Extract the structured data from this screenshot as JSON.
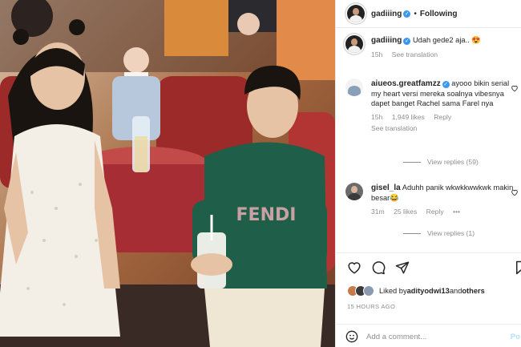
{
  "post": {
    "username": "gadiiing",
    "follow_status": "Following",
    "separator": "•",
    "caption": "Udah gede2 aja.. 😍",
    "caption_time": "15h",
    "see_translation": "See translation"
  },
  "comments": [
    {
      "username": "aiueos.greatfamzz",
      "text": "ayooo bikin serial my heart versi mereka soalnya vibesnya dapet banget Rachel sama Farel nya",
      "time": "15h",
      "likes": "1,949 likes",
      "reply": "Reply",
      "see_translation": "See translation",
      "view_replies": "View replies (59)"
    },
    {
      "username": "gisel_la",
      "text": "Aduhh panik wkwkkwwkwk makin besar😂",
      "time": "31m",
      "likes": "25 likes",
      "reply": "Reply",
      "more": "•••",
      "view_replies": "View replies (1)"
    }
  ],
  "likes_bar": {
    "liked_by_prefix": "Liked by ",
    "liked_by_user": "adityodwi13",
    "and": " and ",
    "others": "others",
    "time_ago": "15 HOURS AGO"
  },
  "comment_box": {
    "placeholder": "Add a comment...",
    "post_label": "Po"
  },
  "photo": {
    "shirt_text": "FENDI"
  },
  "colors": {
    "verified": "#3897f0",
    "shirt": "#1f5e49",
    "post_button": "#b2dffc"
  },
  "icons": [
    "verified-badge-icon",
    "heart-icon",
    "comment-icon",
    "share-icon",
    "bookmark-icon",
    "emoji-icon"
  ]
}
